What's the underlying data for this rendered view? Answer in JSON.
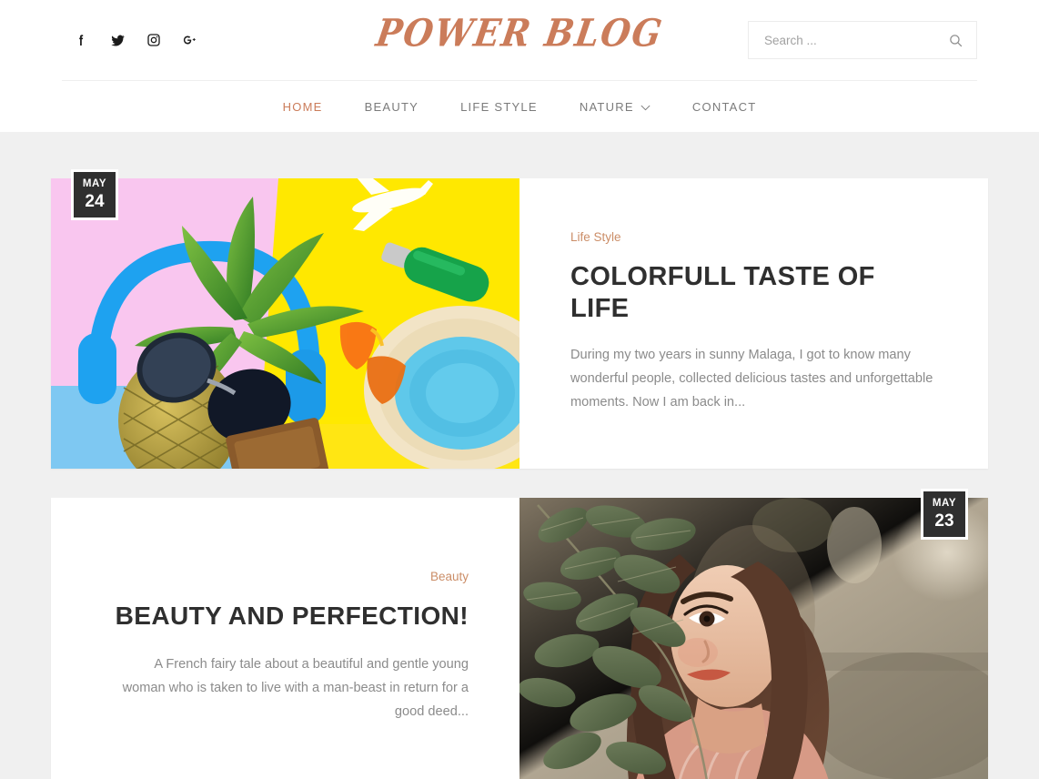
{
  "header": {
    "logo": "POWER BLOG",
    "accent_color": "#cb7c5a",
    "social": [
      {
        "name": "facebook",
        "label": "Facebook"
      },
      {
        "name": "twitter",
        "label": "Twitter"
      },
      {
        "name": "instagram",
        "label": "Instagram"
      },
      {
        "name": "googleplus",
        "label": "Google Plus"
      }
    ],
    "search": {
      "placeholder": "Search ...",
      "value": "",
      "icon": "search-icon"
    }
  },
  "nav": {
    "items": [
      {
        "label": "HOME",
        "active": true,
        "has_dropdown": false
      },
      {
        "label": "BEAUTY",
        "active": false,
        "has_dropdown": false
      },
      {
        "label": "LIFE STYLE",
        "active": false,
        "has_dropdown": false
      },
      {
        "label": "NATURE",
        "active": false,
        "has_dropdown": true
      },
      {
        "label": "CONTACT",
        "active": false,
        "has_dropdown": false
      }
    ],
    "caret": "⌄"
  },
  "posts": [
    {
      "date": {
        "month": "MAY",
        "day": "24"
      },
      "category": "Life Style",
      "title": "COLORFULL TASTE OF LIFE",
      "excerpt": "During my two years in sunny Malaga, I got to know many wonderful people, collected delicious tastes and unforgettable moments. Now I am back in...",
      "image_alt": "summer-flatlay-pineapple-headphones-sunglasses-hat-photo",
      "media_side": "left"
    },
    {
      "date": {
        "month": "MAY",
        "day": "23"
      },
      "category": "Beauty",
      "title": "BEAUTY AND PERFECTION!",
      "excerpt": "A French fairy tale about a beautiful and gentle young woman who is taken to live with a man-beast in return for a good deed...",
      "image_alt": "portrait-woman-behind-green-leaves-photo",
      "media_side": "right"
    }
  ]
}
